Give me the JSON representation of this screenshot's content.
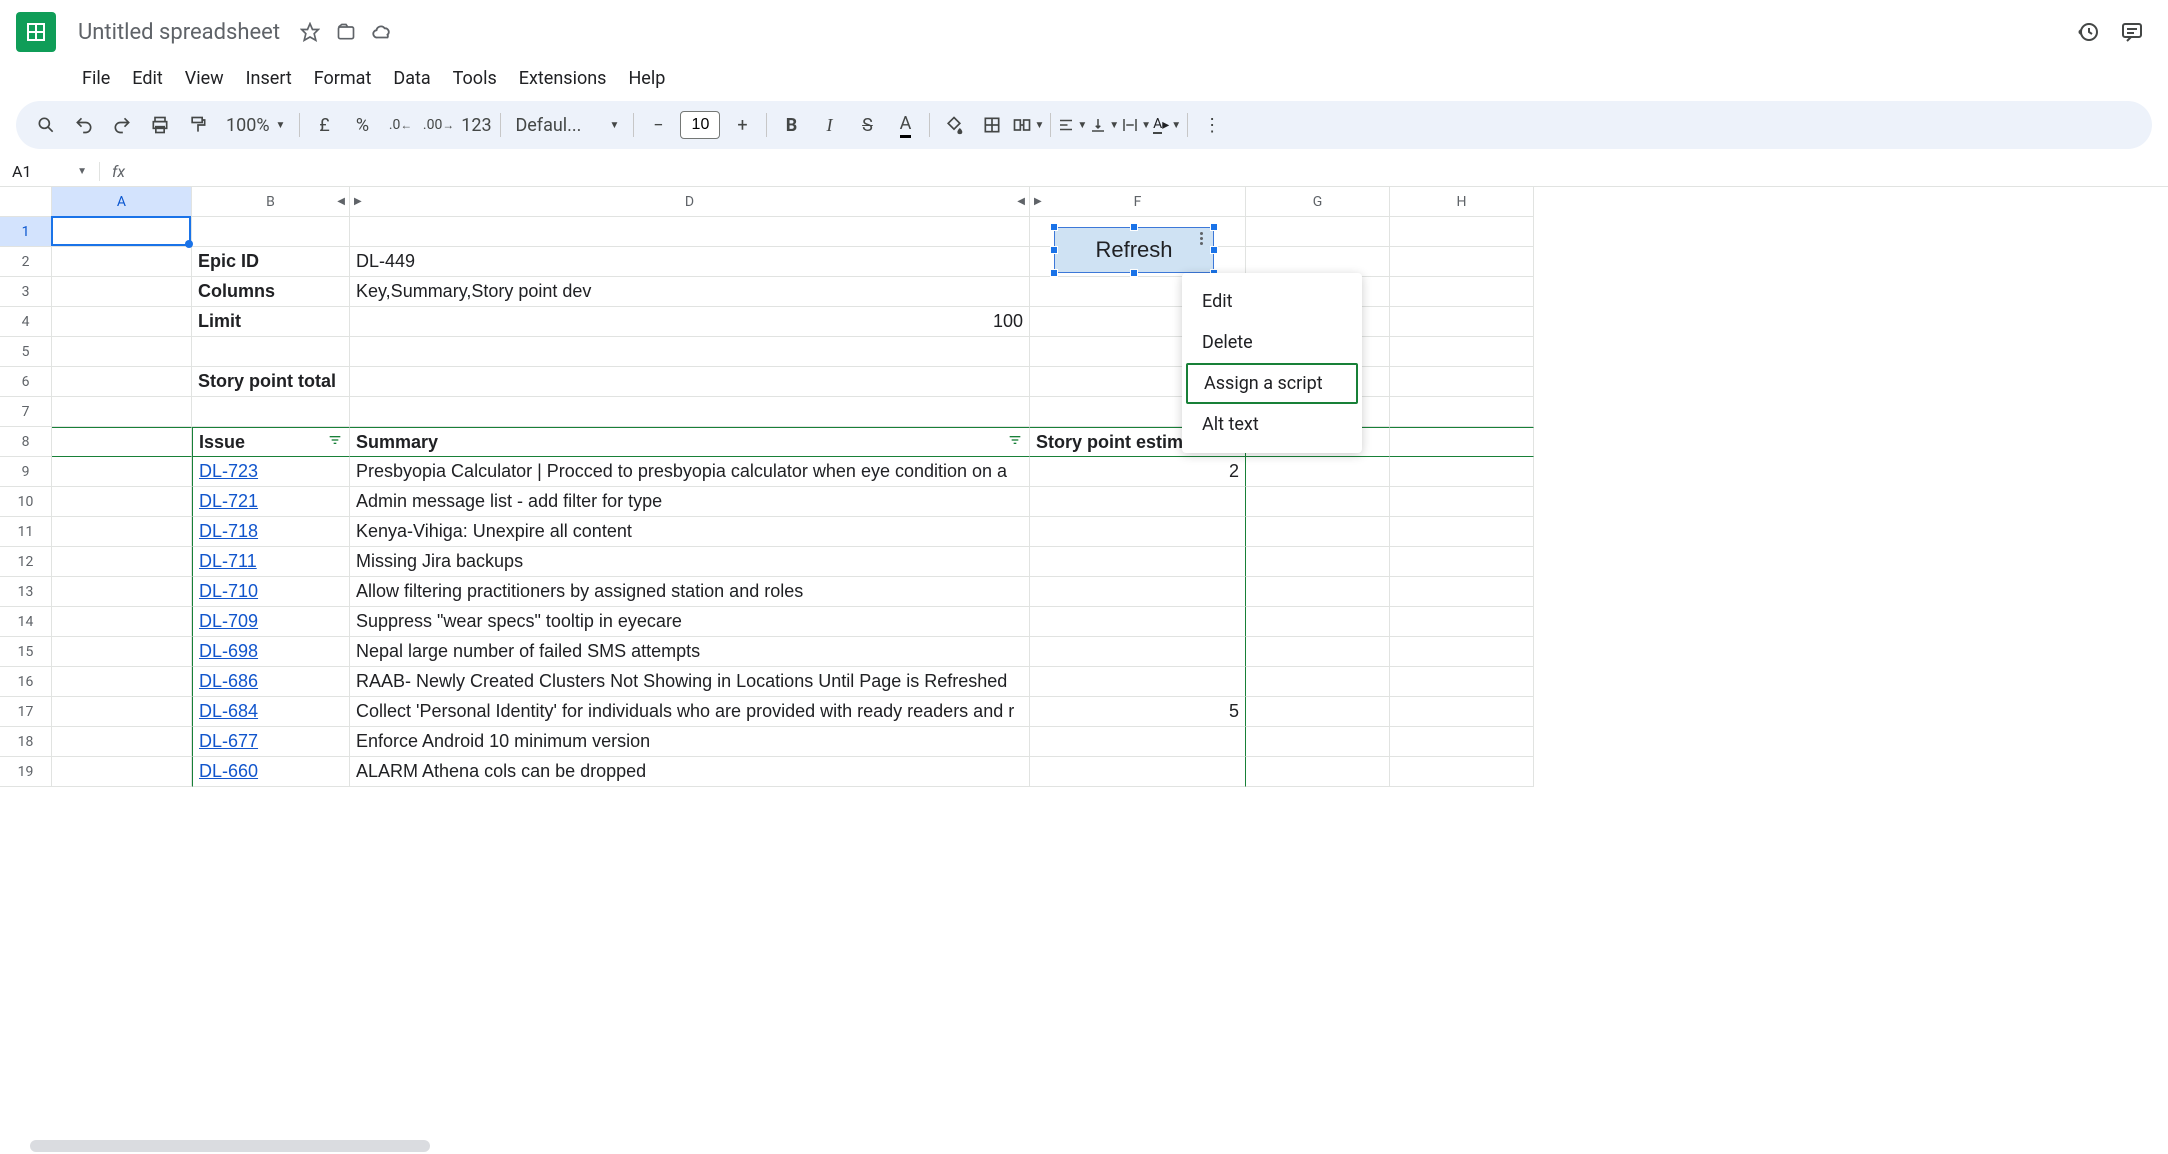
{
  "doc": {
    "title": "Untitled spreadsheet"
  },
  "menus": [
    "File",
    "Edit",
    "View",
    "Insert",
    "Format",
    "Data",
    "Tools",
    "Extensions",
    "Help"
  ],
  "toolbar": {
    "zoom": "100%",
    "font": "Defaul...",
    "fontsize": "10",
    "currency": "£",
    "percent": "%",
    "dec_dec": ".0",
    "inc_dec": ".00",
    "num_fmt": "123"
  },
  "namebox": "A1",
  "fx": "fx",
  "columns": [
    "A",
    "B",
    "D",
    "F",
    "G",
    "H"
  ],
  "labels": {
    "epic_id": "Epic ID",
    "epic_id_val": "DL-449",
    "columns": "Columns",
    "columns_val": "Key,Summary,Story point dev",
    "limit": "Limit",
    "limit_val": "100",
    "sp_total": "Story point total",
    "issue": "Issue",
    "summary": "Summary",
    "sp_est": "Story point estimate"
  },
  "issues": [
    {
      "key": "DL-723",
      "summary": "Presbyopia Calculator | Procced to presbyopia calculator when eye condition on a",
      "sp": "2"
    },
    {
      "key": "DL-721",
      "summary": "Admin message list - add filter for type",
      "sp": ""
    },
    {
      "key": "DL-718",
      "summary": "Kenya-Vihiga: Unexpire all content",
      "sp": ""
    },
    {
      "key": "DL-711",
      "summary": "Missing Jira backups",
      "sp": ""
    },
    {
      "key": "DL-710",
      "summary": "Allow filtering practitioners by assigned station and roles",
      "sp": ""
    },
    {
      "key": "DL-709",
      "summary": "Suppress \"wear specs\" tooltip in eyecare",
      "sp": ""
    },
    {
      "key": "DL-698",
      "summary": "Nepal large number of failed SMS attempts",
      "sp": ""
    },
    {
      "key": "DL-686",
      "summary": "RAAB- Newly Created Clusters Not Showing in Locations Until Page is Refreshed",
      "sp": ""
    },
    {
      "key": "DL-684",
      "summary": "Collect 'Personal Identity' for individuals who are provided with ready readers and r",
      "sp": "5"
    },
    {
      "key": "DL-677",
      "summary": "Enforce Android 10 minimum version",
      "sp": ""
    },
    {
      "key": "DL-660",
      "summary": "ALARM Athena cols can be dropped",
      "sp": ""
    }
  ],
  "drawing": {
    "label": "Refresh"
  },
  "context_menu": [
    "Edit",
    "Delete",
    "Assign a script",
    "Alt text"
  ]
}
